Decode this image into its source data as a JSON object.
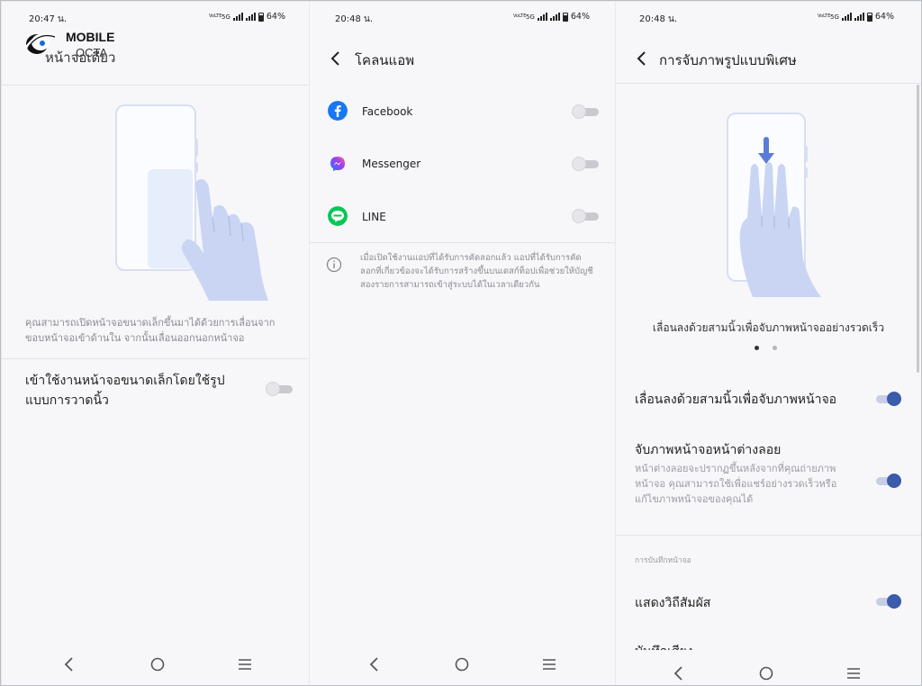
{
  "panel1": {
    "status_time": "20:47 น.",
    "status_battery": "64%",
    "status_net_top": "VoLTE",
    "status_5g": "5G",
    "title": "หน้าจอเดียว",
    "logo": {
      "line1": "MOBILE",
      "line2": "OCTA"
    },
    "description": "คุณสามารถเปิดหน้าจอขนาดเล็กขึ้นมาได้ด้วยการเลื่อนจากขอบหน้าจอเข้าด้านใน จากนั้นเลื่อนออกนอกหน้าจอ",
    "setting_label": "เข้าใช้งานหน้าจอขนาดเล็กโดยใช้รูปแบบการวาดนิ้ว",
    "setting_on": false
  },
  "panel2": {
    "status_time": "20:48 น.",
    "status_battery": "64%",
    "status_net_top": "VoLTE",
    "status_5g": "5G",
    "title": "โคลนแอพ",
    "apps": [
      {
        "name": "Facebook",
        "icon": "facebook-icon",
        "on": false
      },
      {
        "name": "Messenger",
        "icon": "messenger-icon",
        "on": false
      },
      {
        "name": "LINE",
        "icon": "line-icon",
        "on": false
      }
    ],
    "info_text": "เมื่อเปิดใช้งานแอปที่ได้รับการคัดลอกแล้ว แอปที่ได้รับการคัดลอกที่เกี่ยวข้องจะได้รับการสร้างขึ้นบนเดสก์ท็อปเพื่อช่วยให้บัญชีสองรายการสามารถเข้าสู่ระบบได้ในเวลาเดียวกัน"
  },
  "panel3": {
    "status_time": "20:48 น.",
    "status_battery": "64%",
    "status_net_top": "VoLTE",
    "status_5g": "5G",
    "title": "การจับภาพรูปแบบพิเศษ",
    "illustration_caption": "เลื่อนลงด้วยสามนิ้วเพื่อจับภาพหน้าจออย่างรวดเร็ว",
    "page_dots": {
      "count": 2,
      "active": 1
    },
    "settings": [
      {
        "label": "เลื่อนลงด้วยสามนิ้วเพื่อจับภาพหน้าจอ",
        "on": true
      },
      {
        "label": "จับภาพหน้าจอหน้าต่างลอย",
        "desc": "หน้าต่างลอยจะปรากฏขึ้นหลังจากที่คุณถ่ายภาพหน้าจอ คุณสามารถใช้เพื่อแชร์อย่างรวดเร็วหรือแก้ไขภาพหน้าจอของคุณได้",
        "on": true
      }
    ],
    "section_header": "การบันทึกหน้าจอ",
    "settings2": [
      {
        "label": "แสดงวิถีสัมผัส",
        "on": true
      },
      {
        "label": "บันทึกเสียง"
      }
    ]
  },
  "colors": {
    "accent": "#3b5bab",
    "illustration": "#c9d5f2",
    "background": "#f7f7fa"
  }
}
